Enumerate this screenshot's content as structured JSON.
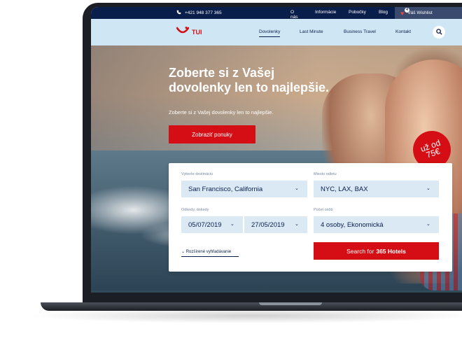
{
  "topbar": {
    "phone": "+421 948 377 365",
    "links": [
      "O nás",
      "Informácie",
      "Pobočky",
      "Blog"
    ],
    "wishlist_label": "Váš Wishlist",
    "wishlist_count": "4"
  },
  "navbar": {
    "logo_text": "TUI",
    "items": [
      {
        "label": "Dovolenky",
        "active": true
      },
      {
        "label": "Last Minute",
        "active": false
      },
      {
        "label": "Business Travel",
        "active": false
      },
      {
        "label": "Kontakt",
        "active": false
      }
    ]
  },
  "hero": {
    "title_line1": "Zoberte si z Vašej",
    "title_line2": "dovolenky len to najlepšie.",
    "subtitle": "Zoberte si z Vašej dovolenky len to najlepšie.",
    "cta_label": "Zobraziť ponuky",
    "badge_line1": "už od",
    "badge_line2": "75€"
  },
  "search": {
    "destination_label": "Vyberte destináciu",
    "destination_value": "San Francisco, California",
    "departure_label": "Miesto odletu",
    "departure_value": "NYC, LAX, BAX",
    "dates_label": "Odkedy, dokedy",
    "date_from": "05/07/2019",
    "date_to": "27/05/2019",
    "persons_label": "Počet osôb",
    "persons_value": "4 osoby, Ekonomická",
    "advanced_label": "Rozšírené vyhľadávanie",
    "submit_prefix": "Search for",
    "submit_bold": "365 Hotels"
  },
  "colors": {
    "brand_red": "#d40e14",
    "navy": "#0a1e4b",
    "field_bg": "#dbe9f5"
  }
}
